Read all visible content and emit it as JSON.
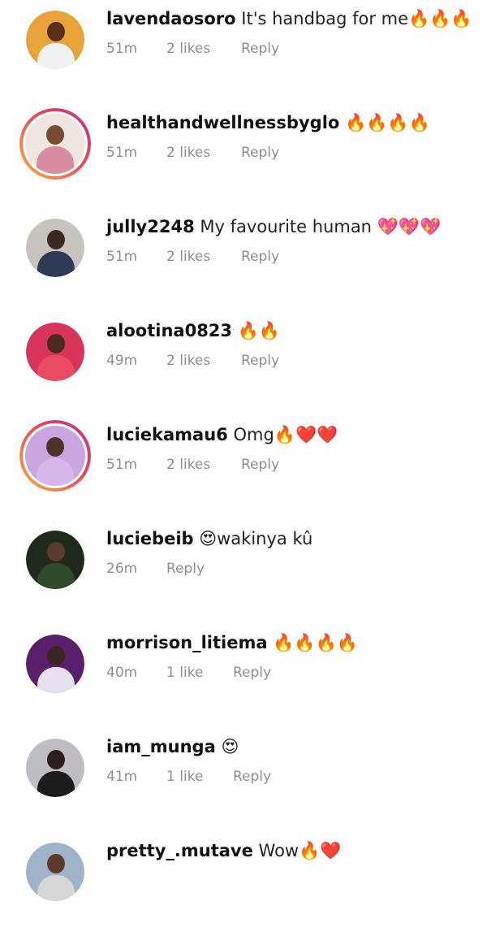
{
  "comments": [
    {
      "username": "lavendaosoro",
      "text": "It's handbag for me🔥🔥🔥",
      "time": "51m",
      "likes": "2 likes",
      "reply": "Reply",
      "story_ring": false,
      "avatar_bg": "#e8a33a",
      "avatar_fg": "#5a2f1a",
      "avatar_shirt": "#f1f1f1"
    },
    {
      "username": "healthandwellnessbyglo",
      "text": "🔥🔥🔥🔥",
      "time": "51m",
      "likes": "2 likes",
      "reply": "Reply",
      "story_ring": true,
      "avatar_bg": "#efe6e0",
      "avatar_fg": "#7a4a36",
      "avatar_shirt": "#d98ca0"
    },
    {
      "username": "jully2248",
      "text": "My favourite human 💖💖💖",
      "time": "51m",
      "likes": "2 likes",
      "reply": "Reply",
      "story_ring": false,
      "avatar_bg": "#c9c3bd",
      "avatar_fg": "#3b2a22",
      "avatar_shirt": "#2f3a57"
    },
    {
      "username": "alootina0823",
      "text": "🔥🔥",
      "time": "49m",
      "likes": "2 likes",
      "reply": "Reply",
      "story_ring": false,
      "avatar_bg": "#d8345a",
      "avatar_fg": "#4a2a22",
      "avatar_shirt": "#e94c62"
    },
    {
      "username": "luciekamau6",
      "text": "Omg🔥❤️❤️",
      "time": "51m",
      "likes": "2 likes",
      "reply": "Reply",
      "story_ring": true,
      "avatar_bg": "#c9a6de",
      "avatar_fg": "#4d3326",
      "avatar_shirt": "#d7b7ea"
    },
    {
      "username": "luciebeib",
      "text": "😍wakinya kû",
      "time": "26m",
      "likes": "",
      "reply": "Reply",
      "story_ring": false,
      "avatar_bg": "#1e2a1c",
      "avatar_fg": "#5b3b2c",
      "avatar_shirt": "#2f4a2a"
    },
    {
      "username": "morrison_litiema",
      "text": "🔥🔥🔥🔥",
      "time": "40m",
      "likes": "1 like",
      "reply": "Reply",
      "story_ring": false,
      "avatar_bg": "#5a1f6b",
      "avatar_fg": "#3a2520",
      "avatar_shirt": "#e7e0ee"
    },
    {
      "username": "iam_munga",
      "text": "😍",
      "time": "41m",
      "likes": "1 like",
      "reply": "Reply",
      "story_ring": false,
      "avatar_bg": "#bfbcc3",
      "avatar_fg": "#2b1f1c",
      "avatar_shirt": "#1c1c1c"
    },
    {
      "username": "pretty_.mutave",
      "text": "Wow🔥❤️",
      "time": "",
      "likes": "",
      "reply": "",
      "story_ring": false,
      "avatar_bg": "#9fb4c9",
      "avatar_fg": "#5a3b2c",
      "avatar_shirt": "#d7d7d7"
    }
  ]
}
